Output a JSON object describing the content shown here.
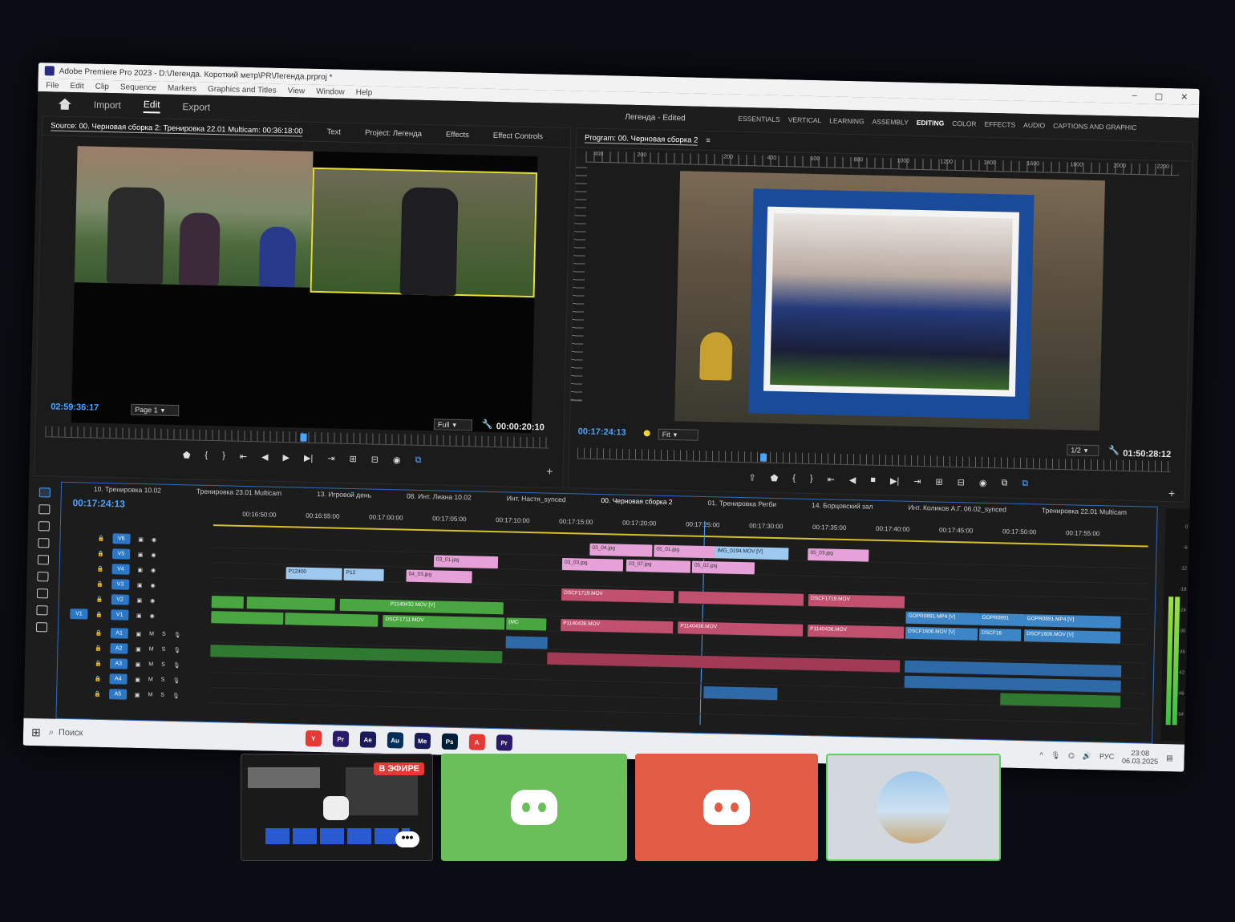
{
  "window": {
    "title": "Adobe Premiere Pro 2023 - D:\\Легенда. Короткий метр\\PR\\Легенда.prproj *",
    "project_header": "Легенда - Edited"
  },
  "menu": [
    "File",
    "Edit",
    "Clip",
    "Sequence",
    "Markers",
    "Graphics and Titles",
    "View",
    "Window",
    "Help"
  ],
  "workspace_nav": {
    "import": "Import",
    "edit": "Edit",
    "export": "Export"
  },
  "workspaces": [
    "ESSENTIALS",
    "VERTICAL",
    "LEARNING",
    "ASSEMBLY",
    "EDITING",
    "COLOR",
    "EFFECTS",
    "AUDIO",
    "CAPTIONS AND GRAPHIC"
  ],
  "source_panel": {
    "tabs": [
      "Source: 00. Черновая сборка 2: Тренировка 22.01 Multicam: 00:36:18:00",
      "Text",
      "Project: Легенда",
      "Effects",
      "Effect Controls"
    ],
    "timecode_left": "02:59:36:17",
    "page_select": "Page 1",
    "zoom_select": "Full",
    "timecode_right": "00:00:20:10"
  },
  "program_panel": {
    "tab": "Program: 00. Черновая сборка 2",
    "ruler_marks": [
      "400",
      "200",
      "",
      "200",
      "400",
      "600",
      "800",
      "1000",
      "1200",
      "1400",
      "1600",
      "1800",
      "2000",
      "2200"
    ],
    "timecode_left": "00:17:24:13",
    "fit_select": "Fit",
    "quality_select": "1/2",
    "timecode_right": "01:50:28:12"
  },
  "timeline": {
    "tabs": [
      "10. Тренировка 10.02",
      "Тренировка 23.01 Multicam",
      "13. Игровой день",
      "08. Инт. Лиана 10.02",
      "Инт. Настя_synced",
      "00. Черновая сборка 2",
      "01. Тренировка Регби",
      "14. Борцовский зал",
      "Инт. Коликов А.Г. 06.02_synced",
      "Тренировка 22.01 Multicam"
    ],
    "current_timecode": "00:17:24:13",
    "ruler": [
      "00:16:50:00",
      "00:16:55:00",
      "00:17:00:00",
      "00:17:05:00",
      "00:17:10:00",
      "00:17:15:00",
      "00:17:20:00",
      "00:17:25:00",
      "00:17:30:00",
      "00:17:35:00",
      "00:17:40:00",
      "00:17:45:00",
      "00:17:50:00",
      "00:17:55:00"
    ],
    "video_tracks": [
      "V6",
      "V5",
      "V4",
      "V3",
      "V2",
      "V1"
    ],
    "audio_tracks": [
      "A1",
      "A2",
      "A3",
      "A4",
      "A5"
    ],
    "source_patch": "V1",
    "clip_labels": {
      "v6_1": "03_04.jpg",
      "v6_2": "05_01.jpg",
      "v6_3": "IMG_0194.MOV [V]",
      "v6_4": "05_03.jpg",
      "v5_1": "03_01.jpg",
      "v5_2": "03_03.jpg",
      "v5_3": "03_07.jpg",
      "v5_4": "05_02.jpg",
      "v4_1": "P12400",
      "v4_2": "P12",
      "v4_3": "04_03.jpg",
      "v3_1": "DSCF1719.MOV",
      "v3_2": "DSCF1719.MOV",
      "v3_3": "DSCF1719.MOV",
      "v2_1": "P1140432.MOV [V]",
      "v2_2": "GOPR0891.MP4 [V]",
      "v2_3": "GOPR0891",
      "v2_4": "GOPR0891.MP4 [V]",
      "v1_1": "DSCF1711.MOV",
      "v1_2": "(MC",
      "v1_3": "P1140436.MOV",
      "v1_4": "P1140436.MOV",
      "v1_5": "P1140436.MOV",
      "v1_6": "DSCF1606.MOV [V]",
      "v1_7": "DSCF16",
      "v1_8": "DSCF1606.MOV [V]"
    },
    "meter_scale": [
      "0",
      "-6",
      "-12",
      "-18",
      "-24",
      "-30",
      "-36",
      "-42",
      "-48",
      "-54"
    ]
  },
  "taskbar": {
    "search_placeholder": "Поиск",
    "apps": [
      {
        "label": "Y",
        "color": "#e53935"
      },
      {
        "label": "Pr",
        "color": "#2a1a6a"
      },
      {
        "label": "Ae",
        "color": "#1a1a5a"
      },
      {
        "label": "Au",
        "color": "#00305a"
      },
      {
        "label": "Me",
        "color": "#1a1a5a"
      },
      {
        "label": "Ps",
        "color": "#001e36"
      },
      {
        "label": "A",
        "color": "#e53935"
      },
      {
        "label": "Pr",
        "color": "#2a1a6a"
      }
    ],
    "lang": "РУС",
    "time": "23:08",
    "date": "06.03.2025"
  },
  "call_tiles": {
    "live_badge": "В ЭФИРЕ",
    "colors": {
      "green": "#6abf5b",
      "red": "#e25b45",
      "avatar_border": "#5bd05b"
    }
  }
}
